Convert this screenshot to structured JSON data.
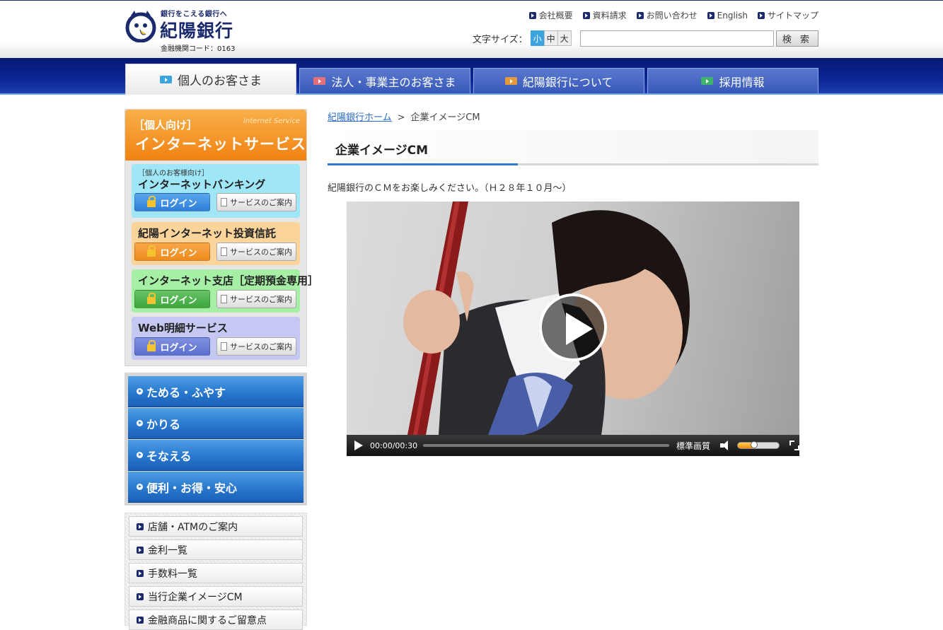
{
  "header": {
    "logo_tagline": "銀行をこえる銀行へ",
    "logo_name": "紀陽銀行",
    "logo_code": "金融機関コード：0163",
    "util_links": [
      "会社概要",
      "資料請求",
      "お問い合わせ",
      "English",
      "サイトマップ"
    ],
    "font_size_label": "文字サイズ：",
    "font_size_options": [
      "小",
      "中",
      "大"
    ],
    "font_size_selected": "小",
    "search_value": "",
    "search_button": "検 索"
  },
  "gnav": {
    "tabs": [
      {
        "label": "個人のお客さま",
        "active": true,
        "icon_color": "#3aa3e0"
      },
      {
        "label": "法人・事業主のお客さま",
        "active": false,
        "icon_color": "#e6707a"
      },
      {
        "label": "紀陽銀行について",
        "active": false,
        "icon_color": "#e59a3a"
      },
      {
        "label": "採用情報",
        "active": false,
        "icon_color": "#3fb36a"
      }
    ]
  },
  "sidebar": {
    "internet_service": {
      "subtitle": "Internet Service",
      "title1": "［個人向け］",
      "title2": "インターネットサービス",
      "services": [
        {
          "pre": "［個人のお客様向け］",
          "title": "インターネットバンキング",
          "login": "ログイン",
          "guide": "サービスのご案内",
          "bg": "#9fe6f6",
          "btn_color": "#2f7fd8"
        },
        {
          "pre": "",
          "title": "紀陽インターネット投資信託",
          "login": "ログイン",
          "guide": "サービスのご案内",
          "bg": "#fbd49c",
          "btn_color": "#ee8a1c"
        },
        {
          "pre": "",
          "title": "インターネット支店［定期預金専用］",
          "login": "ログイン",
          "guide": "サービスのご案内",
          "bg": "#a6f0a6",
          "btn_color": "#3fa63f"
        },
        {
          "pre": "",
          "title": "Web明細サービス",
          "login": "ログイン",
          "guide": "サービスのご案内",
          "bg": "#c4c8f2",
          "btn_color": "#5a6fcf"
        }
      ]
    },
    "categories": [
      "ためる・ふやす",
      "かりる",
      "そなえる",
      "便利・お得・安心"
    ],
    "links": [
      "店舗・ATMのご案内",
      "金利一覧",
      "手数料一覧",
      "当行企業イメージCM",
      "金融商品に関するご留意点"
    ]
  },
  "main": {
    "breadcrumb_home": "紀陽銀行ホーム",
    "breadcrumb_sep": ">",
    "breadcrumb_current": "企業イメージCM",
    "page_title": "企業イメージCM",
    "intro": "紀陽銀行のＣＭをお楽しみください。（Ｈ２８年１０月～）",
    "video": {
      "time": "00:00/00:30",
      "quality": "標準画質",
      "volume_fraction": 0.4
    }
  },
  "colors": {
    "brand_navy": "#1a2a6c",
    "nav_blue": "#0b2596",
    "accent_blue": "#2b7bd0",
    "orange": "#f08212"
  }
}
